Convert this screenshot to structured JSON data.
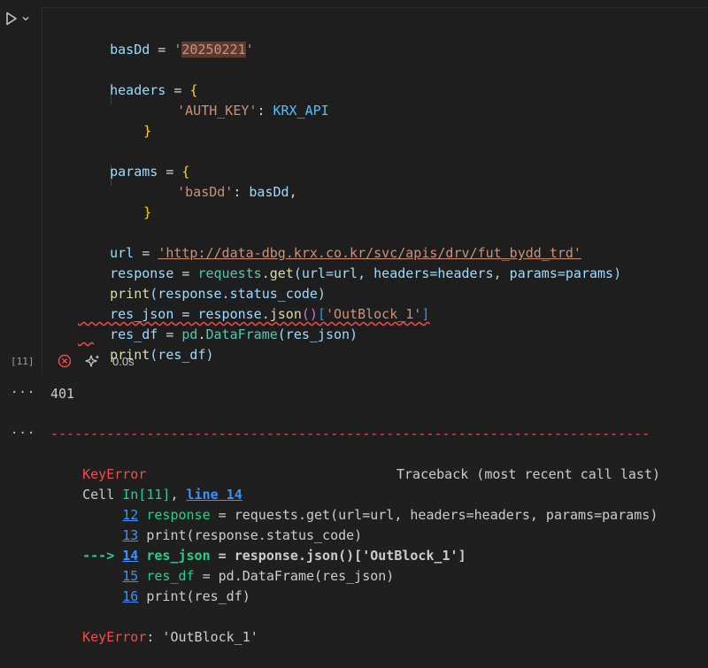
{
  "cell": {
    "execution_count": "[11]",
    "exec_time": "0.0s",
    "code": {
      "l1_var": "basDd",
      "l1_eq": " = ",
      "l1_str": "'20250221'",
      "l2_var": "headers",
      "l2_eq": " = ",
      "l2_brace_open": "{",
      "l3_key": "'AUTH_KEY'",
      "l3_colon": ": ",
      "l3_val": "KRX_API",
      "l4_brace_close": "}",
      "l5_var": "params",
      "l5_eq": " = ",
      "l5_brace_open": "{",
      "l6_key": "'basDd'",
      "l6_colon": ": ",
      "l6_val": "basDd",
      "l6_comma": ",",
      "l7_brace_close": "}",
      "l8_var": "url",
      "l8_eq": " = ",
      "l8_str": "'http://data-dbg.krx.co.kr/svc/apis/drv/fut_bydd_trd'",
      "l9_var": "response",
      "l9_eq": " = ",
      "l9_mod": "requests",
      "l9_dot": ".",
      "l9_fn": "get",
      "l9_args": "(url=url, headers=headers, params=params)",
      "l10_fn": "print",
      "l10_args": "(response.status_code)",
      "l11_var": "res_json",
      "l11_eq": " = ",
      "l11_obj": "response",
      "l11_dot": ".",
      "l11_fn": "json",
      "l11_call": "()",
      "l11_bo": "[",
      "l11_str": "'OutBlock_1'",
      "l11_bc": "]",
      "l12_var": "res_df",
      "l12_eq": " = ",
      "l12_mod": "pd",
      "l12_dot": ".",
      "l12_cls": "DataFrame",
      "l12_args": "(res_json)",
      "l13_fn": "print",
      "l13_args": "(res_df)"
    }
  },
  "outputs": {
    "ellipsis": "···",
    "status_code": "401",
    "dashes": "---------------------------------------------------------------------------",
    "error_name": "KeyError",
    "traceback_label": "Traceback (most recent call last)",
    "cell_prefix": "Cell ",
    "cell_ref": "In[11]",
    "cell_sep": ", ",
    "line_ref": "line 14",
    "tb": [
      {
        "arrow": "     ",
        "num": "12",
        "code_a": " response",
        "code_b": " = requests.get(url=url, headers=headers, params=params)"
      },
      {
        "arrow": "     ",
        "num": "13",
        "code_a": " print(response.status_code)",
        "code_b": ""
      },
      {
        "arrow": "---> ",
        "num": "14",
        "code_a": " res_json",
        "code_b": " = response.json()['OutBlock_1']"
      },
      {
        "arrow": "     ",
        "num": "15",
        "code_a": " res_df",
        "code_b": " = pd.DataFrame(res_json)"
      },
      {
        "arrow": "     ",
        "num": "16",
        "code_a": " print(res_df)",
        "code_b": ""
      }
    ],
    "final_error_name": "KeyError",
    "final_error_msg": ": 'OutBlock_1'"
  },
  "icons": {
    "run": "play-icon",
    "run_menu": "chevron-down-icon",
    "error": "error-circle-icon",
    "sparkle": "sparkle-icon"
  },
  "colors": {
    "error": "#f14c4c",
    "accent": "#3794ff",
    "success": "#23d18b"
  }
}
